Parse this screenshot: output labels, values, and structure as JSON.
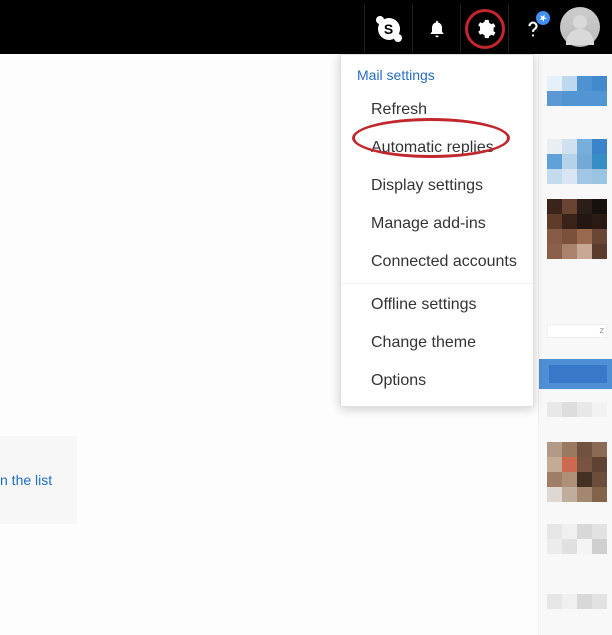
{
  "topbar": {
    "icons": {
      "skype": "S",
      "bell": "Notifications",
      "gear": "Settings",
      "help": "?",
      "avatar": "User"
    }
  },
  "dropdown": {
    "header": "Mail settings",
    "items": [
      "Refresh",
      "Automatic replies",
      "Display settings",
      "Manage add-ins",
      "Connected accounts",
      "Offline settings",
      "Change theme",
      "Options"
    ]
  },
  "listbox_text": "n the list",
  "highlighted_item_index": 1
}
